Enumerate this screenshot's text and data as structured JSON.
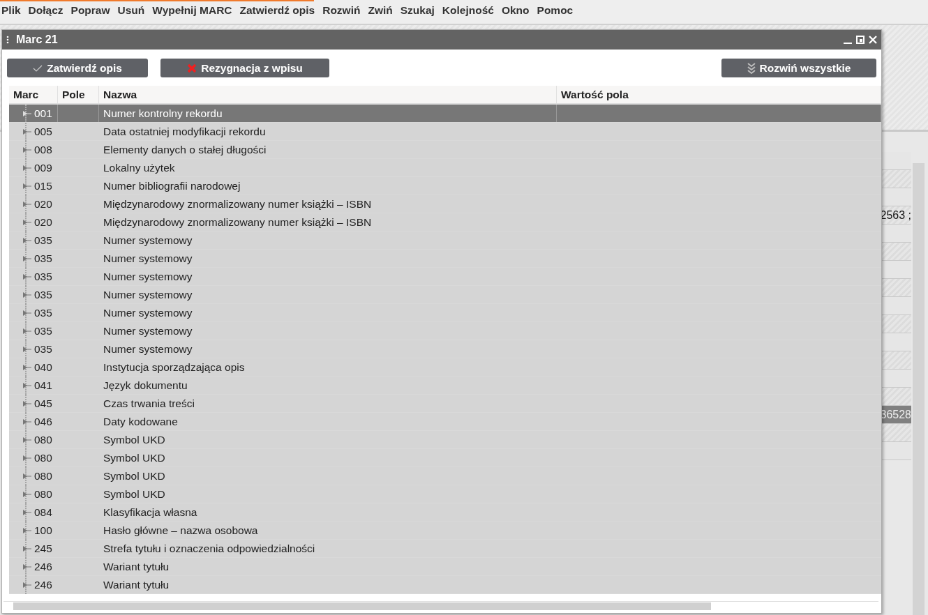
{
  "menu": [
    {
      "label": "Plik"
    },
    {
      "label": "Dołącz"
    },
    {
      "label": "Popraw"
    },
    {
      "label": "Usuń"
    },
    {
      "label": "Wypełnij MARC"
    },
    {
      "label": "Zatwierdź opis"
    },
    {
      "label": "Rozwiń"
    },
    {
      "label": "Zwiń"
    },
    {
      "label": "Szukaj"
    },
    {
      "label": "Kolejność"
    },
    {
      "label": "Okno"
    },
    {
      "label": "Pomoc"
    }
  ],
  "background_cells": [
    "2563 ;",
    "36528"
  ],
  "window": {
    "title": "Marc 21"
  },
  "buttons": [
    {
      "kind": "confirm",
      "label": "Zatwierdź opis"
    },
    {
      "kind": "cancel",
      "label": "Rezygnacja z wpisu"
    },
    {
      "kind": "expand",
      "label": "Rozwiń wszystkie"
    }
  ],
  "table": {
    "columns": [
      "Marc",
      "Pole",
      "Nazwa",
      "Wartość pola"
    ],
    "rows": [
      {
        "marc": "001",
        "name": "Numer kontrolny rekordu",
        "selected": true
      },
      {
        "marc": "005",
        "name": "Data ostatniej modyfikacji rekordu",
        "selected": false
      },
      {
        "marc": "008",
        "name": "Elementy danych o stałej długości",
        "selected": false
      },
      {
        "marc": "009",
        "name": "Lokalny użytek",
        "selected": false
      },
      {
        "marc": "015",
        "name": "Numer bibliografii narodowej",
        "selected": false
      },
      {
        "marc": "020",
        "name": "Międzynarodowy znormalizowany numer książki – ISBN",
        "selected": false
      },
      {
        "marc": "020",
        "name": "Międzynarodowy znormalizowany numer książki – ISBN",
        "selected": false
      },
      {
        "marc": "035",
        "name": "Numer systemowy",
        "selected": false
      },
      {
        "marc": "035",
        "name": "Numer systemowy",
        "selected": false
      },
      {
        "marc": "035",
        "name": "Numer systemowy",
        "selected": false
      },
      {
        "marc": "035",
        "name": "Numer systemowy",
        "selected": false
      },
      {
        "marc": "035",
        "name": "Numer systemowy",
        "selected": false
      },
      {
        "marc": "035",
        "name": "Numer systemowy",
        "selected": false
      },
      {
        "marc": "035",
        "name": "Numer systemowy",
        "selected": false
      },
      {
        "marc": "040",
        "name": "Instytucja sporządzająca opis",
        "selected": false
      },
      {
        "marc": "041",
        "name": "Język dokumentu",
        "selected": false
      },
      {
        "marc": "045",
        "name": "Czas trwania treści",
        "selected": false
      },
      {
        "marc": "046",
        "name": "Daty kodowane",
        "selected": false
      },
      {
        "marc": "080",
        "name": "Symbol UKD",
        "selected": false
      },
      {
        "marc": "080",
        "name": "Symbol UKD",
        "selected": false
      },
      {
        "marc": "080",
        "name": "Symbol UKD",
        "selected": false
      },
      {
        "marc": "080",
        "name": "Symbol UKD",
        "selected": false
      },
      {
        "marc": "084",
        "name": "Klasyfikacja własna",
        "selected": false
      },
      {
        "marc": "100",
        "name": "Hasło główne – nazwa osobowa",
        "selected": false
      },
      {
        "marc": "245",
        "name": "Strefa tytułu i oznaczenia odpowiedzialności",
        "selected": false
      },
      {
        "marc": "246",
        "name": "Wariant tytułu",
        "selected": false
      },
      {
        "marc": "246",
        "name": "Wariant tytułu",
        "selected": false
      }
    ]
  }
}
